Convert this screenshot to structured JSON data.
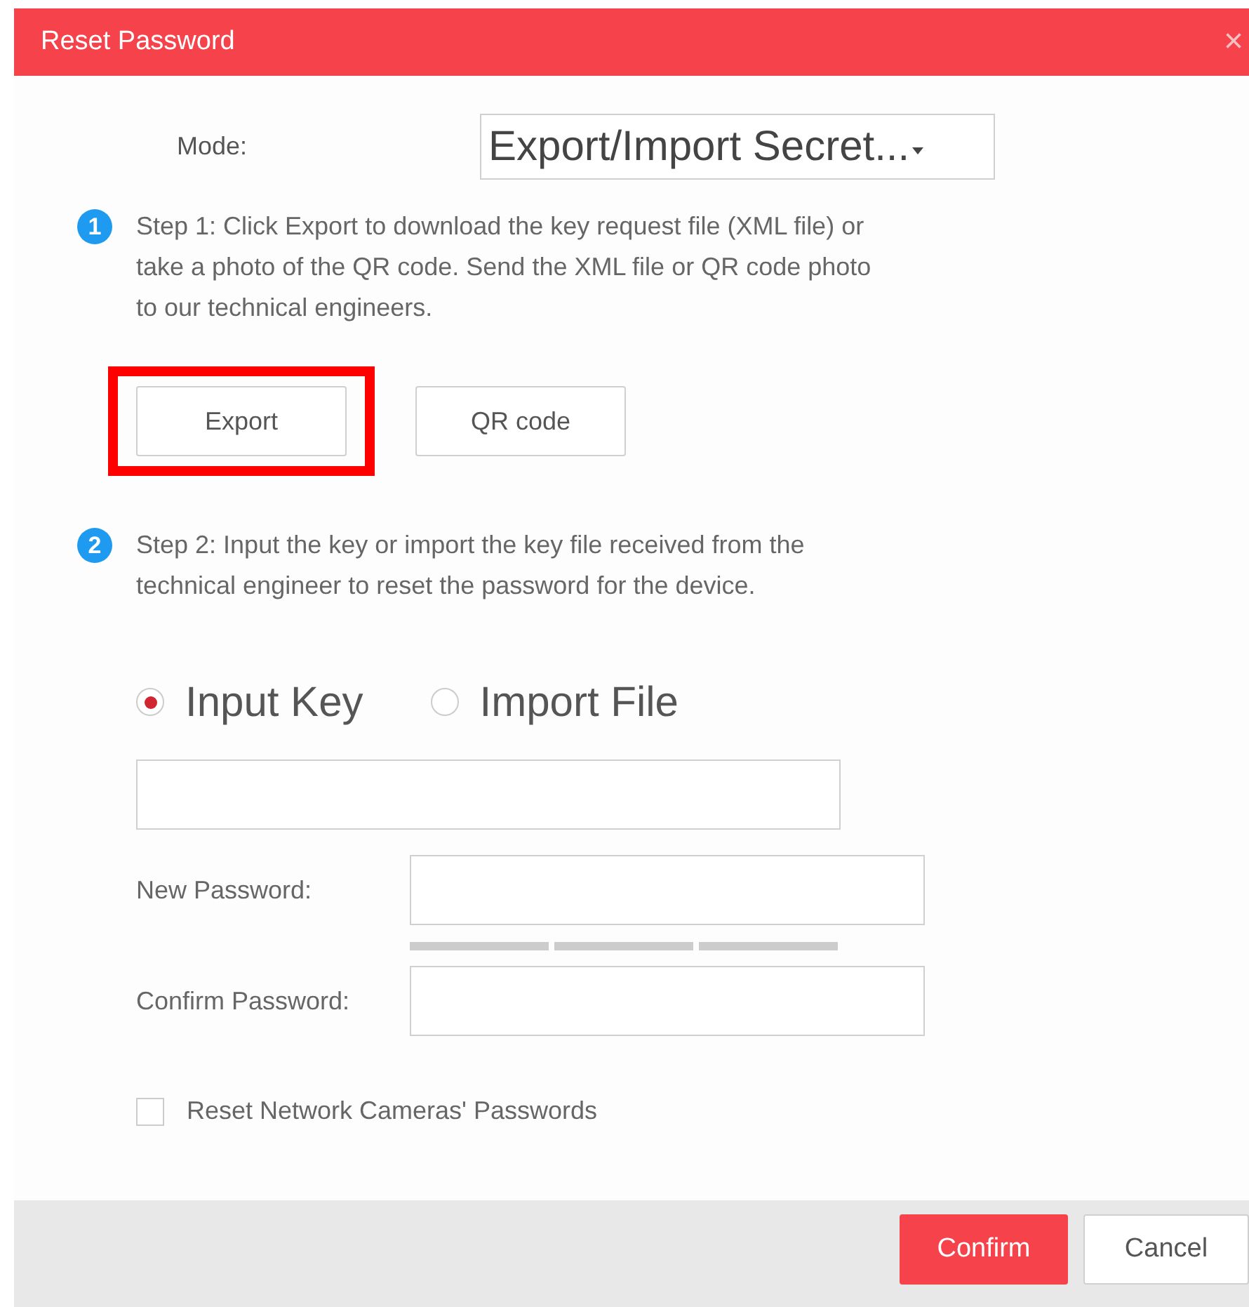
{
  "window": {
    "title": "Reset Password",
    "close": "×"
  },
  "mode": {
    "label": "Mode:",
    "value": "Export/Import Secret..."
  },
  "steps": [
    {
      "number": "1",
      "text": "Step 1: Click Export to download the key request file (XML file) or take a photo of the QR code. Send the XML file or QR code photo to our technical engineers."
    },
    {
      "number": "2",
      "text": "Step 2: Input the key or import the key file received from the technical engineer to reset the password for the device."
    }
  ],
  "step1_buttons": [
    {
      "label": "Export",
      "highlighted": true
    },
    {
      "label": "QR code",
      "highlighted": false
    }
  ],
  "key_source": [
    {
      "label": "Input Key",
      "selected": true
    },
    {
      "label": "Import File",
      "selected": false
    }
  ],
  "password_fields": [
    {
      "label": "New Password:",
      "strength_meter": true
    },
    {
      "label": "Confirm Password:",
      "strength_meter": false
    }
  ],
  "reset_cameras": {
    "label": "Reset Network Cameras' Passwords",
    "checked": false
  },
  "buttons": [
    {
      "label": "Confirm",
      "primary": true
    },
    {
      "label": "Cancel",
      "primary": false
    }
  ]
}
